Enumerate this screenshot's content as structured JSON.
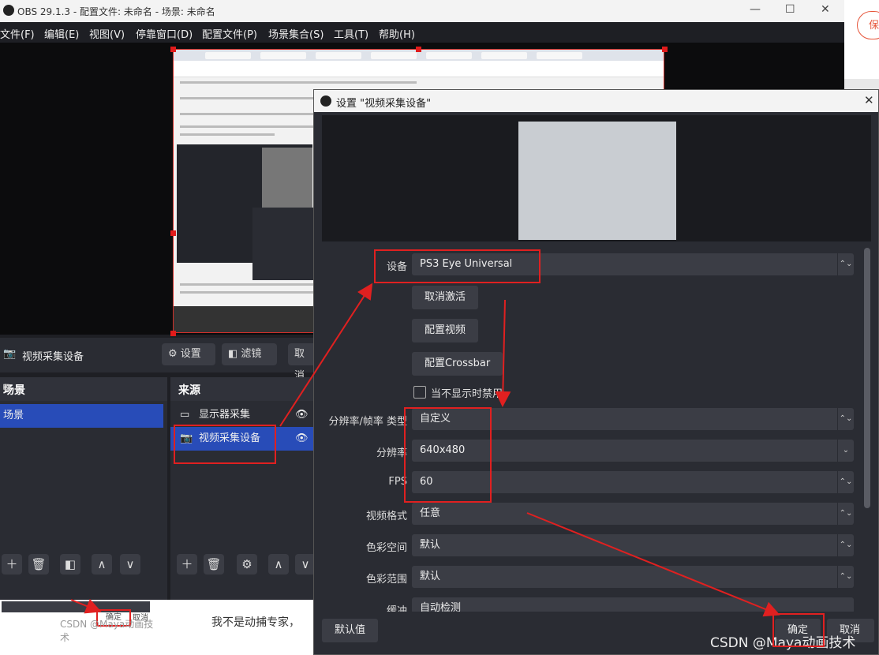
{
  "obs": {
    "title": "OBS 29.1.3 - 配置文件: 未命名 - 场景: 未命名",
    "menu": [
      "文件(F)",
      "编辑(E)",
      "视图(V)",
      "停靠窗口(D)",
      "配置文件(P)",
      "场景集合(S)",
      "工具(T)",
      "帮助(H)"
    ],
    "source_toolbar": {
      "selected": "视频采集设备",
      "settings": "设置",
      "filters": "滤镜",
      "deactivate": "取消"
    },
    "scenes": {
      "title": "场景",
      "items": [
        "场景"
      ]
    },
    "sources": {
      "title": "来源",
      "items": [
        {
          "name": "显示器采集"
        },
        {
          "name": "视频采集设备"
        }
      ]
    }
  },
  "right_panel": {
    "button": "保"
  },
  "background_web": {
    "text": "我不是动捕专家，",
    "watermark": "CSDN @Maya动画技术",
    "mini_buttons": [
      "确定",
      "取消"
    ]
  },
  "dialog": {
    "title": "设置 \"视频采集设备\"",
    "device_label": "设备",
    "device_value": "PS3 Eye Universal",
    "deactivate": "取消激活",
    "config_video": "配置视频",
    "config_crossbar": "配置Crossbar",
    "disable_when_hidden": "当不显示时禁用",
    "rows": [
      {
        "label": "分辨率/帧率 类型",
        "value": "自定义"
      },
      {
        "label": "分辨率",
        "value": "640x480"
      },
      {
        "label": "FPS",
        "value": "60"
      },
      {
        "label": "视频格式",
        "value": "任意"
      },
      {
        "label": "色彩空间",
        "value": "默认"
      },
      {
        "label": "色彩范围",
        "value": "默认"
      },
      {
        "label": "缓冲",
        "value": "自动检测"
      }
    ],
    "defaults": "默认值",
    "ok": "确定",
    "cancel": "取消"
  },
  "watermark": "CSDN @Maya动画技术",
  "colors": {
    "accent": "#284cb8",
    "annotation": "#e02020"
  }
}
